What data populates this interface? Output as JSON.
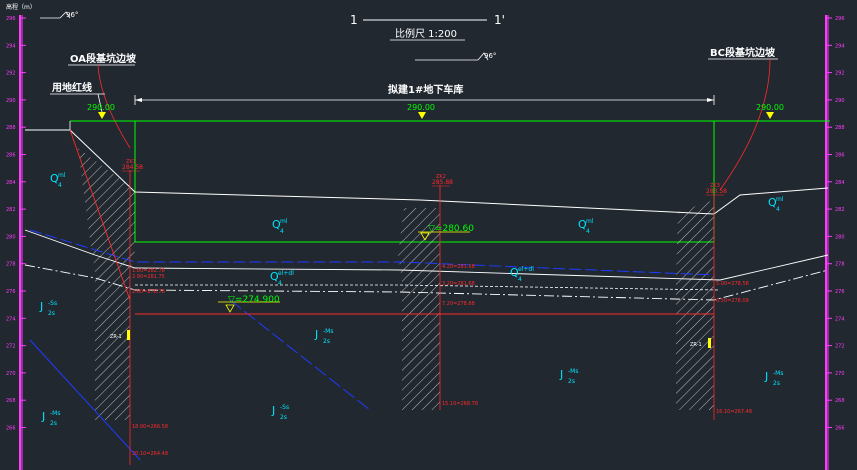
{
  "header": {
    "elevation_axis_label": "高程（m）",
    "scale_left": "1",
    "scale_right": "1'",
    "scale_text": "比例尺 1:200",
    "north_angle_top": "96°",
    "north_angle_mid": "96°"
  },
  "axis_left": {
    "ticks": [
      "296",
      "294",
      "292",
      "290",
      "288",
      "286",
      "284",
      "282",
      "280",
      "278",
      "276",
      "274",
      "272",
      "270",
      "268",
      "266"
    ]
  },
  "axis_right": {
    "ticks": [
      "296",
      "294",
      "292",
      "290",
      "288",
      "286",
      "284",
      "282",
      "280",
      "278",
      "276",
      "274",
      "272",
      "270",
      "268",
      "266"
    ]
  },
  "labels": {
    "red_line": "用地红线",
    "left_slope": "OA段基坑边坡",
    "right_slope": "BC段基坑边坡",
    "garage": "拟建1#地下车库",
    "level_left": "290.00",
    "level_mid": "290.00",
    "level_right": "290.00",
    "water_mid": "▽=280.60",
    "water_left": "▽=274.900"
  },
  "strata": [
    {
      "name": "Q",
      "sup": "ml",
      "sub": "4"
    },
    {
      "name": "Q",
      "sup": "ml",
      "sub": "4"
    },
    {
      "name": "Q",
      "sup": "ml",
      "sub": "4"
    },
    {
      "name": "Q",
      "sup": "ml",
      "sub": "4"
    },
    {
      "name": "Q",
      "sup": "el+dl",
      "sub": "4"
    },
    {
      "name": "Q",
      "sup": "el+dl",
      "sub": "4"
    },
    {
      "name": "J",
      "sup": "-Ss",
      "sub": "2s"
    },
    {
      "name": "J",
      "sup": "-Ms",
      "sub": "2s"
    },
    {
      "name": "J",
      "sup": "-Ms",
      "sub": "2s"
    },
    {
      "name": "J",
      "sup": "-Ss",
      "sub": "2s"
    },
    {
      "name": "J",
      "sup": "-Ms",
      "sub": "2s"
    },
    {
      "name": "J",
      "sup": "-Ms",
      "sub": "2s"
    }
  ],
  "boreholes": [
    {
      "id": "ZK1",
      "top_elev": "284.58",
      "notes": [
        "1.80=282.78",
        "2.90=281.75",
        "2.80=278.78"
      ],
      "bottom": [
        "18.00=266.58",
        "20.10=264.48"
      ]
    },
    {
      "id": "ZK2",
      "top_elev": "285.88",
      "notes": [
        "4.20=281.68",
        "3.20=281.68",
        "7.20=278.68"
      ],
      "bottom": [
        "15.10=268.78"
      ]
    },
    {
      "id": "ZK3",
      "top_elev": "283.58",
      "notes": [
        "5.00=278.58",
        "6.50=278.09"
      ],
      "bottom": [
        "16.10=267.48"
      ]
    }
  ],
  "colors": {
    "background": "#212830",
    "design_line": "#00ff00",
    "red": "#ff2a2a",
    "cyan": "#00e5ff",
    "magenta": "#ff3cff",
    "blue_dash": "#1e3cff",
    "yellow": "#ffff00"
  }
}
